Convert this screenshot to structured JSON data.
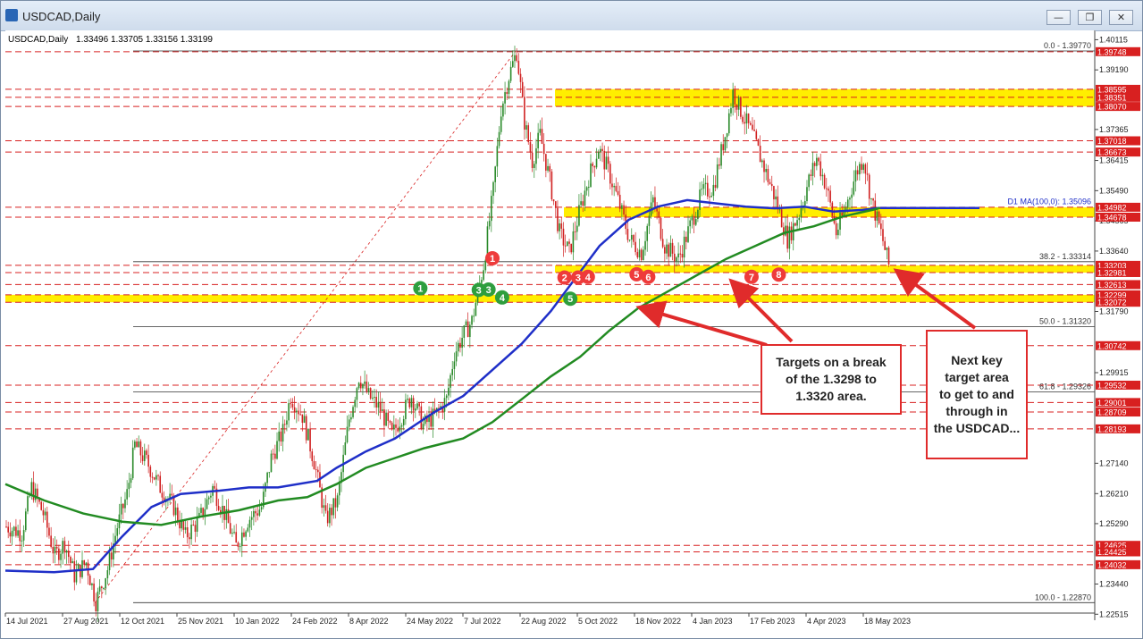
{
  "window": {
    "title": "USDCAD,Daily",
    "minimize_label": "—",
    "restore_label": "❐",
    "close_label": "✕"
  },
  "header": {
    "symbol": "USDCAD,Daily",
    "ohlc": "1.33496 1.33705 1.33156 1.33199"
  },
  "colors": {
    "ma100": "#1f2fc8",
    "ma200": "#228b22",
    "level_line": "#d82020",
    "zone": "#ffee00",
    "up_candle": "#2a8a2a",
    "down_candle": "#d02020",
    "marker_red": "#ee3b3b",
    "marker_green": "#2e9e3e"
  },
  "chart_data": {
    "type": "candlestick",
    "symbol": "USDCAD",
    "timeframe": "Daily",
    "ylim": [
      1.2255,
      1.404
    ],
    "y_ticks": [
      1.40115,
      1.3919,
      1.37365,
      1.36415,
      1.3549,
      1.34565,
      1.3364,
      1.3179,
      1.29915,
      1.2714,
      1.2621,
      1.2529,
      1.2344,
      1.22515
    ],
    "x_tick_labels": [
      "14 Jul 2021",
      "27 Aug 2021",
      "12 Oct 2021",
      "25 Nov 2021",
      "10 Jan 2022",
      "24 Feb 2022",
      "8 Apr 2022",
      "24 May 2022",
      "7 Jul 2022",
      "22 Aug 2022",
      "5 Oct 2022",
      "18 Nov 2022",
      "4 Jan 2023",
      "17 Feb 2023",
      "4 Apr 2023",
      "18 May 2023"
    ],
    "price_path": [
      [
        0,
        1.252
      ],
      [
        8,
        1.25
      ],
      [
        13,
        1.264
      ],
      [
        19,
        1.256
      ],
      [
        25,
        1.243
      ],
      [
        30,
        1.247
      ],
      [
        35,
        1.237
      ],
      [
        41,
        1.241
      ],
      [
        46,
        1.229
      ],
      [
        52,
        1.239
      ],
      [
        57,
        1.252
      ],
      [
        62,
        1.262
      ],
      [
        66,
        1.277
      ],
      [
        72,
        1.272
      ],
      [
        79,
        1.264
      ],
      [
        86,
        1.258
      ],
      [
        92,
        1.249
      ],
      [
        99,
        1.254
      ],
      [
        106,
        1.264
      ],
      [
        112,
        1.256
      ],
      [
        118,
        1.246
      ],
      [
        124,
        1.254
      ],
      [
        131,
        1.258
      ],
      [
        136,
        1.273
      ],
      [
        142,
        1.281
      ],
      [
        146,
        1.292
      ],
      [
        152,
        1.286
      ],
      [
        158,
        1.272
      ],
      [
        164,
        1.254
      ],
      [
        170,
        1.26
      ],
      [
        176,
        1.285
      ],
      [
        181,
        1.298
      ],
      [
        186,
        1.292
      ],
      [
        192,
        1.288
      ],
      [
        198,
        1.28
      ],
      [
        203,
        1.286
      ],
      [
        208,
        1.292
      ],
      [
        214,
        1.283
      ],
      [
        220,
        1.286
      ],
      [
        226,
        1.291
      ],
      [
        230,
        1.305
      ],
      [
        234,
        1.31
      ],
      [
        239,
        1.315
      ],
      [
        245,
        1.332
      ],
      [
        250,
        1.355
      ],
      [
        254,
        1.38
      ],
      [
        258,
        1.39
      ],
      [
        262,
        1.3975
      ],
      [
        266,
        1.376
      ],
      [
        270,
        1.364
      ],
      [
        274,
        1.372
      ],
      [
        279,
        1.358
      ],
      [
        284,
        1.342
      ],
      [
        289,
        1.336
      ],
      [
        294,
        1.348
      ],
      [
        299,
        1.359
      ],
      [
        304,
        1.368
      ],
      [
        309,
        1.361
      ],
      [
        314,
        1.352
      ],
      [
        320,
        1.34
      ],
      [
        326,
        1.336
      ],
      [
        332,
        1.352
      ],
      [
        338,
        1.338
      ],
      [
        345,
        1.334
      ],
      [
        351,
        1.344
      ],
      [
        357,
        1.354
      ],
      [
        363,
        1.356
      ],
      [
        369,
        1.372
      ],
      [
        373,
        1.385
      ],
      [
        378,
        1.378
      ],
      [
        383,
        1.372
      ],
      [
        389,
        1.362
      ],
      [
        395,
        1.352
      ],
      [
        401,
        1.34
      ],
      [
        407,
        1.348
      ],
      [
        412,
        1.358
      ],
      [
        416,
        1.365
      ],
      [
        421,
        1.356
      ],
      [
        426,
        1.342
      ],
      [
        431,
        1.35
      ],
      [
        436,
        1.36
      ],
      [
        440,
        1.365
      ],
      [
        444,
        1.352
      ],
      [
        449,
        1.342
      ],
      [
        453,
        1.332
      ]
    ],
    "series": [
      {
        "name": "MA 100",
        "values": [
          [
            0,
            1.2385
          ],
          [
            25,
            1.238
          ],
          [
            45,
            1.239
          ],
          [
            60,
            1.249
          ],
          [
            75,
            1.258
          ],
          [
            90,
            1.262
          ],
          [
            110,
            1.263
          ],
          [
            125,
            1.264
          ],
          [
            140,
            1.264
          ],
          [
            160,
            1.266
          ],
          [
            170,
            1.27
          ],
          [
            185,
            1.275
          ],
          [
            200,
            1.279
          ],
          [
            210,
            1.283
          ],
          [
            220,
            1.287
          ],
          [
            235,
            1.292
          ],
          [
            250,
            1.3
          ],
          [
            265,
            1.308
          ],
          [
            280,
            1.318
          ],
          [
            295,
            1.33
          ],
          [
            305,
            1.338
          ],
          [
            320,
            1.346
          ],
          [
            335,
            1.35
          ],
          [
            350,
            1.352
          ],
          [
            365,
            1.351
          ],
          [
            380,
            1.35
          ],
          [
            395,
            1.3495
          ],
          [
            410,
            1.35
          ],
          [
            425,
            1.3485
          ],
          [
            440,
            1.349
          ],
          [
            448,
            1.3496
          ],
          [
            500,
            1.3496
          ]
        ]
      },
      {
        "name": "MA 200",
        "values": [
          [
            0,
            1.265
          ],
          [
            20,
            1.26
          ],
          [
            40,
            1.256
          ],
          [
            60,
            1.2535
          ],
          [
            80,
            1.2525
          ],
          [
            100,
            1.255
          ],
          [
            120,
            1.257
          ],
          [
            140,
            1.26
          ],
          [
            155,
            1.261
          ],
          [
            170,
            1.265
          ],
          [
            185,
            1.27
          ],
          [
            200,
            1.273
          ],
          [
            215,
            1.276
          ],
          [
            235,
            1.279
          ],
          [
            250,
            1.284
          ],
          [
            265,
            1.291
          ],
          [
            280,
            1.298
          ],
          [
            295,
            1.304
          ],
          [
            310,
            1.312
          ],
          [
            325,
            1.319
          ],
          [
            340,
            1.324
          ],
          [
            355,
            1.329
          ],
          [
            370,
            1.334
          ],
          [
            385,
            1.338
          ],
          [
            400,
            1.342
          ],
          [
            415,
            1.344
          ],
          [
            430,
            1.347
          ],
          [
            445,
            1.349
          ],
          [
            449,
            1.3496
          ]
        ]
      }
    ],
    "indicator_label": "D1 MA(100,0): 1.35096",
    "yellow_zones": [
      [
        1.3807,
        1.386
      ],
      [
        1.3468,
        1.3498
      ],
      [
        1.3298,
        1.332
      ],
      [
        1.3207,
        1.323
      ]
    ],
    "level_lines": [
      1.39748,
      1.38595,
      1.38351,
      1.3807,
      1.37018,
      1.36673,
      1.34982,
      1.34678,
      1.33203,
      1.32981,
      1.32613,
      1.32299,
      1.32072,
      1.30742,
      1.29532,
      1.29001,
      1.28709,
      1.28193,
      1.24625,
      1.24425,
      1.24032
    ],
    "level_labels": [
      "1.39748",
      "1.38595",
      "1.38351",
      "1.38070",
      "1.37018",
      "1.36673",
      "1.34982",
      "1.34678",
      "1.33203",
      "1.32981",
      "1.32613",
      "1.32299",
      "1.32072",
      "1.30742",
      "1.29532",
      "1.29001",
      "1.28709",
      "1.28193",
      "1.24625",
      "1.24425",
      "1.24032"
    ],
    "fib_levels": [
      {
        "label": "0.0 - 1.39770",
        "price": 1.3977
      },
      {
        "label": "38.2 - 1.33314",
        "price": 1.33314
      },
      {
        "label": "50.0 - 1.31320",
        "price": 1.3132
      },
      {
        "label": "61.8 - 1.29326",
        "price": 1.29326
      },
      {
        "label": "100.0 - 1.22870",
        "price": 1.2287
      }
    ],
    "fib_trendline": {
      "from": [
        46,
        1.2287
      ],
      "to": [
        262,
        1.3977
      ]
    },
    "markers": [
      {
        "label": "1",
        "color": "red",
        "i": 250,
        "price": 1.3342
      },
      {
        "label": "2",
        "color": "red",
        "i": 287,
        "price": 1.3283
      },
      {
        "label": "3",
        "color": "red",
        "i": 294,
        "price": 1.3283
      },
      {
        "label": "4",
        "color": "red",
        "i": 299,
        "price": 1.3285
      },
      {
        "label": "5",
        "color": "red",
        "i": 324,
        "price": 1.3293
      },
      {
        "label": "6",
        "color": "red",
        "i": 330,
        "price": 1.3285
      },
      {
        "label": "7",
        "color": "red",
        "i": 383,
        "price": 1.3285
      },
      {
        "label": "8",
        "color": "red",
        "i": 397,
        "price": 1.3292
      },
      {
        "label": "1",
        "color": "green",
        "i": 213,
        "price": 1.325
      },
      {
        "label": "3",
        "color": "green",
        "i": 243,
        "price": 1.3245
      },
      {
        "label": "3",
        "color": "green",
        "i": 248,
        "price": 1.3246
      },
      {
        "label": "4",
        "color": "green",
        "i": 255,
        "price": 1.3222
      },
      {
        "label": "5",
        "color": "green",
        "i": 290,
        "price": 1.3218
      }
    ]
  },
  "annotations": {
    "note_left": "Targets on a break\nof the 1.3298 to\n1.3320 area.",
    "note_right": "Next key\ntarget area\nto get to and\nthrough in\nthe USDCAD..."
  }
}
